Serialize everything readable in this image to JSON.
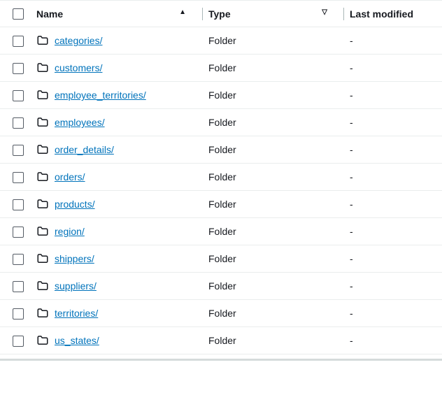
{
  "columns": {
    "name": "Name",
    "type": "Type",
    "lastModified": "Last modified"
  },
  "sort": {
    "ascending": "▲",
    "filter": "▽"
  },
  "rows": [
    {
      "name": "categories/",
      "type": "Folder",
      "lastModified": "-"
    },
    {
      "name": "customers/",
      "type": "Folder",
      "lastModified": "-"
    },
    {
      "name": "employee_territories/",
      "type": "Folder",
      "lastModified": "-"
    },
    {
      "name": "employees/",
      "type": "Folder",
      "lastModified": "-"
    },
    {
      "name": "order_details/",
      "type": "Folder",
      "lastModified": "-"
    },
    {
      "name": "orders/",
      "type": "Folder",
      "lastModified": "-"
    },
    {
      "name": "products/",
      "type": "Folder",
      "lastModified": "-"
    },
    {
      "name": "region/",
      "type": "Folder",
      "lastModified": "-"
    },
    {
      "name": "shippers/",
      "type": "Folder",
      "lastModified": "-"
    },
    {
      "name": "suppliers/",
      "type": "Folder",
      "lastModified": "-"
    },
    {
      "name": "territories/",
      "type": "Folder",
      "lastModified": "-"
    },
    {
      "name": "us_states/",
      "type": "Folder",
      "lastModified": "-"
    }
  ]
}
